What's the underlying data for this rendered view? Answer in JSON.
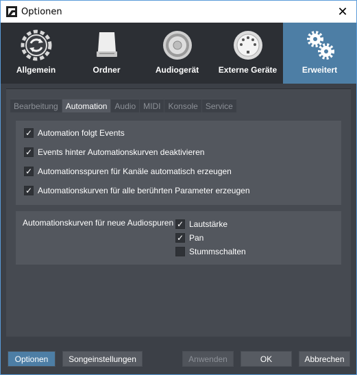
{
  "window": {
    "title": "Optionen",
    "close_glyph": "✕"
  },
  "categories": [
    {
      "label": "Allgemein",
      "icon": "gear-refresh-icon"
    },
    {
      "label": "Ordner",
      "icon": "drive-icon"
    },
    {
      "label": "Audiogerät",
      "icon": "speaker-icon"
    },
    {
      "label": "Externe Geräte",
      "icon": "midi-connector-icon"
    },
    {
      "label": "Erweitert",
      "icon": "gears-icon",
      "active": true
    }
  ],
  "tabs": [
    {
      "label": "Bearbeitung"
    },
    {
      "label": "Automation",
      "active": true
    },
    {
      "label": "Audio"
    },
    {
      "label": "MIDI"
    },
    {
      "label": "Konsole"
    },
    {
      "label": "Service"
    }
  ],
  "automation_options": [
    {
      "label": "Automation folgt Events",
      "checked": true
    },
    {
      "label": "Events hinter Automationskurven deaktivieren",
      "checked": true
    },
    {
      "label": "Automationsspuren für Kanäle automatisch erzeugen",
      "checked": true
    },
    {
      "label": "Automationskurven für alle berührten Parameter erzeugen",
      "checked": true
    }
  ],
  "audio_tracks": {
    "label": "Automationskurven für neue Audiospuren",
    "options": [
      {
        "label": "Lautstärke",
        "checked": true
      },
      {
        "label": "Pan",
        "checked": true
      },
      {
        "label": "Stummschalten",
        "checked": false
      }
    ]
  },
  "footer": {
    "options": "Optionen",
    "song_settings": "Songeinstellungen",
    "apply": "Anwenden",
    "ok": "OK",
    "cancel": "Abbrechen"
  },
  "colors": {
    "accent": "#4d7ea5",
    "panel": "#464a51",
    "toolbar": "#2c2f34"
  },
  "check_glyph": "✓"
}
